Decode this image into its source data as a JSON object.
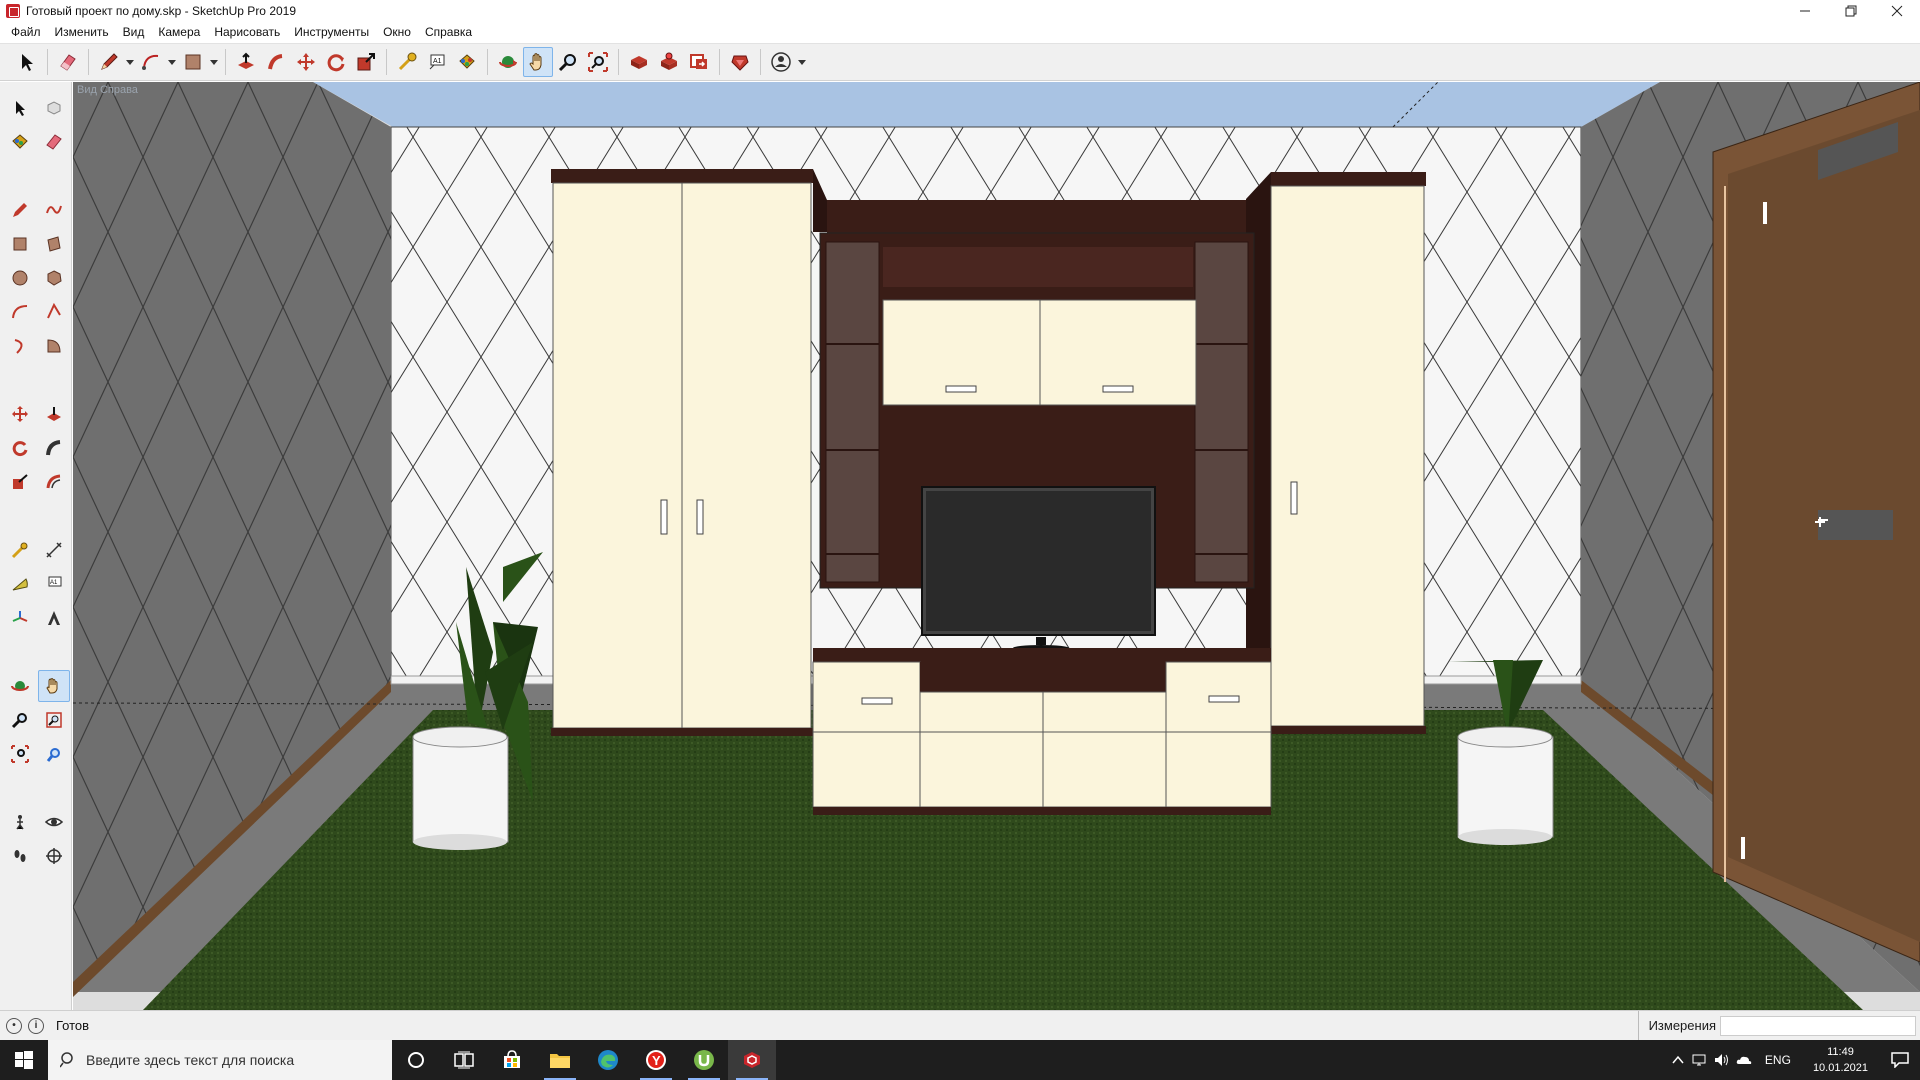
{
  "window": {
    "title": "Готовый проект по дому.skp - SketchUp Pro 2019",
    "controls": [
      "minimize",
      "restore",
      "close"
    ]
  },
  "menu": [
    "Файл",
    "Изменить",
    "Вид",
    "Камера",
    "Нарисовать",
    "Инструменты",
    "Окно",
    "Справка"
  ],
  "toolbar": {
    "tools": [
      "select-icon",
      "eraser-icon",
      "pencil-icon",
      "arc-icon",
      "rectangle-icon",
      "push-pull-icon",
      "follow-me-icon",
      "move-icon",
      "rotate-icon",
      "scale-icon",
      "tape-measure-icon",
      "text-icon",
      "paint-bucket-icon",
      "orbit-icon",
      "pan-icon",
      "zoom-icon",
      "zoom-extents-icon",
      "warehouse-icon",
      "extension-warehouse-icon",
      "layout-icon",
      "extension-manager-icon",
      "account-icon"
    ],
    "active_tool": "pan-icon"
  },
  "viewport": {
    "scene_label": "Вид Справа",
    "colors": {
      "ceiling": "#a9c3e3",
      "wall_back": "#f6f6f6",
      "wall_side": "#6f6f6f",
      "carpet": "#2f4a1c",
      "wood_dark": "#3a1d17",
      "cream": "#fbf5dc",
      "door": "#7a5436",
      "tv_screen": "#2a2a2a"
    }
  },
  "status": {
    "text": "Готов",
    "measurements_label": "Измерения",
    "measurements_value": ""
  },
  "taskbar": {
    "search_placeholder": "Введите здесь текст для поиска",
    "apps": [
      "cortana-icon",
      "task-view-icon",
      "store-icon",
      "explorer-icon",
      "edge-icon",
      "yandex-icon",
      "utorrent-icon",
      "sketchup-icon"
    ],
    "language": "ENG",
    "time": "11:49",
    "date": "10.01.2021"
  }
}
